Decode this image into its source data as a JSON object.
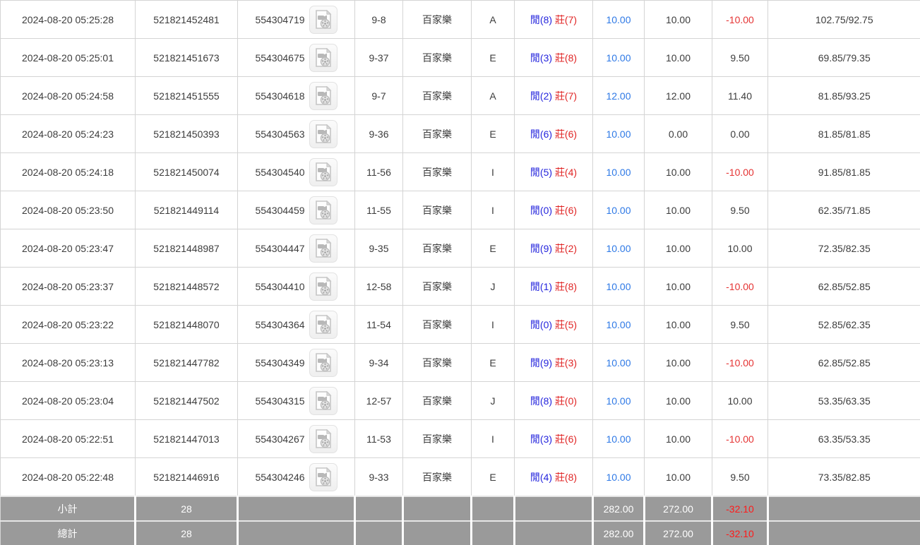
{
  "colors": {
    "link_blue": "#2e79e6",
    "player_blue": "#2525dd",
    "banker_red": "#e02525",
    "negative_red": "#e53333",
    "footer_bg": "#9a9a9a"
  },
  "icons": {
    "video_replay": "video-file-icon"
  },
  "table": {
    "rows": [
      {
        "time": "2024-08-20 05:25:28",
        "order_no": "521821452481",
        "round_no": "554304719",
        "table_round": "9-8",
        "game": "百家樂",
        "table_code": "A",
        "result_player": "閒(8)",
        "result_banker": "莊(7)",
        "bet": "10.00",
        "valid_bet": "10.00",
        "win_loss": "-10.00",
        "balance": "102.75/92.75"
      },
      {
        "time": "2024-08-20 05:25:01",
        "order_no": "521821451673",
        "round_no": "554304675",
        "table_round": "9-37",
        "game": "百家樂",
        "table_code": "E",
        "result_player": "閒(3)",
        "result_banker": "莊(8)",
        "bet": "10.00",
        "valid_bet": "10.00",
        "win_loss": "9.50",
        "balance": "69.85/79.35"
      },
      {
        "time": "2024-08-20 05:24:58",
        "order_no": "521821451555",
        "round_no": "554304618",
        "table_round": "9-7",
        "game": "百家樂",
        "table_code": "A",
        "result_player": "閒(2)",
        "result_banker": "莊(7)",
        "bet": "12.00",
        "valid_bet": "12.00",
        "win_loss": "11.40",
        "balance": "81.85/93.25"
      },
      {
        "time": "2024-08-20 05:24:23",
        "order_no": "521821450393",
        "round_no": "554304563",
        "table_round": "9-36",
        "game": "百家樂",
        "table_code": "E",
        "result_player": "閒(6)",
        "result_banker": "莊(6)",
        "bet": "10.00",
        "valid_bet": "0.00",
        "win_loss": "0.00",
        "balance": "81.85/81.85"
      },
      {
        "time": "2024-08-20 05:24:18",
        "order_no": "521821450074",
        "round_no": "554304540",
        "table_round": "11-56",
        "game": "百家樂",
        "table_code": "I",
        "result_player": "閒(5)",
        "result_banker": "莊(4)",
        "bet": "10.00",
        "valid_bet": "10.00",
        "win_loss": "-10.00",
        "balance": "91.85/81.85"
      },
      {
        "time": "2024-08-20 05:23:50",
        "order_no": "521821449114",
        "round_no": "554304459",
        "table_round": "11-55",
        "game": "百家樂",
        "table_code": "I",
        "result_player": "閒(0)",
        "result_banker": "莊(6)",
        "bet": "10.00",
        "valid_bet": "10.00",
        "win_loss": "9.50",
        "balance": "62.35/71.85"
      },
      {
        "time": "2024-08-20 05:23:47",
        "order_no": "521821448987",
        "round_no": "554304447",
        "table_round": "9-35",
        "game": "百家樂",
        "table_code": "E",
        "result_player": "閒(9)",
        "result_banker": "莊(2)",
        "bet": "10.00",
        "valid_bet": "10.00",
        "win_loss": "10.00",
        "balance": "72.35/82.35"
      },
      {
        "time": "2024-08-20 05:23:37",
        "order_no": "521821448572",
        "round_no": "554304410",
        "table_round": "12-58",
        "game": "百家樂",
        "table_code": "J",
        "result_player": "閒(1)",
        "result_banker": "莊(8)",
        "bet": "10.00",
        "valid_bet": "10.00",
        "win_loss": "-10.00",
        "balance": "62.85/52.85"
      },
      {
        "time": "2024-08-20 05:23:22",
        "order_no": "521821448070",
        "round_no": "554304364",
        "table_round": "11-54",
        "game": "百家樂",
        "table_code": "I",
        "result_player": "閒(0)",
        "result_banker": "莊(5)",
        "bet": "10.00",
        "valid_bet": "10.00",
        "win_loss": "9.50",
        "balance": "52.85/62.35"
      },
      {
        "time": "2024-08-20 05:23:13",
        "order_no": "521821447782",
        "round_no": "554304349",
        "table_round": "9-34",
        "game": "百家樂",
        "table_code": "E",
        "result_player": "閒(9)",
        "result_banker": "莊(3)",
        "bet": "10.00",
        "valid_bet": "10.00",
        "win_loss": "-10.00",
        "balance": "62.85/52.85"
      },
      {
        "time": "2024-08-20 05:23:04",
        "order_no": "521821447502",
        "round_no": "554304315",
        "table_round": "12-57",
        "game": "百家樂",
        "table_code": "J",
        "result_player": "閒(8)",
        "result_banker": "莊(0)",
        "bet": "10.00",
        "valid_bet": "10.00",
        "win_loss": "10.00",
        "balance": "53.35/63.35"
      },
      {
        "time": "2024-08-20 05:22:51",
        "order_no": "521821447013",
        "round_no": "554304267",
        "table_round": "11-53",
        "game": "百家樂",
        "table_code": "I",
        "result_player": "閒(3)",
        "result_banker": "莊(6)",
        "bet": "10.00",
        "valid_bet": "10.00",
        "win_loss": "-10.00",
        "balance": "63.35/53.35"
      },
      {
        "time": "2024-08-20 05:22:48",
        "order_no": "521821446916",
        "round_no": "554304246",
        "table_round": "9-33",
        "game": "百家樂",
        "table_code": "E",
        "result_player": "閒(4)",
        "result_banker": "莊(8)",
        "bet": "10.00",
        "valid_bet": "10.00",
        "win_loss": "9.50",
        "balance": "73.35/82.85"
      }
    ],
    "footer": {
      "subtotal": {
        "label": "小計",
        "count": "28",
        "bet": "282.00",
        "valid_bet": "272.00",
        "win_loss": "-32.10"
      },
      "total": {
        "label": "總計",
        "count": "28",
        "bet": "282.00",
        "valid_bet": "272.00",
        "win_loss": "-32.10"
      }
    }
  }
}
